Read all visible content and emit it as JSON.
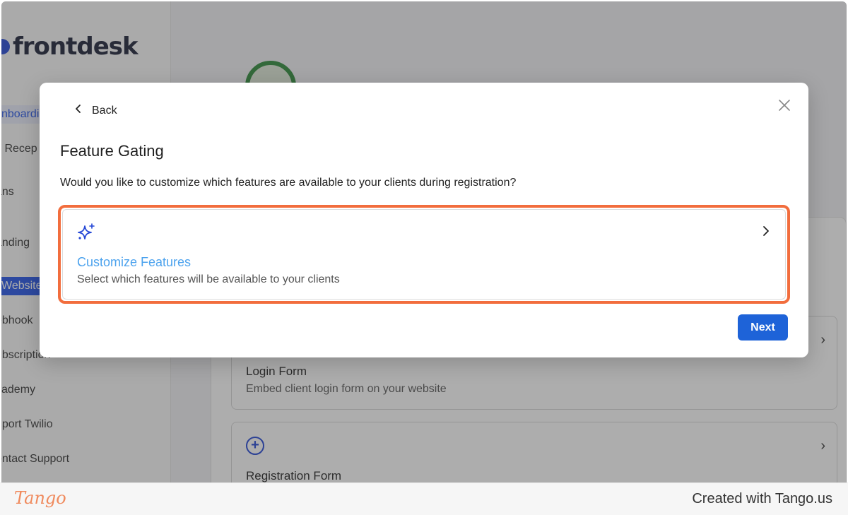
{
  "sidebar": {
    "logo_text": "frontdesk",
    "items": [
      {
        "label": "nboarding"
      },
      {
        "label": "y Recep"
      },
      {
        "label": "ans"
      },
      {
        "label": "anding"
      },
      {
        "label": "Website"
      },
      {
        "label": "ebhook"
      },
      {
        "label": "ubscription"
      },
      {
        "label": "cademy"
      },
      {
        "label": "nport Twilio"
      },
      {
        "label": "ontact Support"
      }
    ]
  },
  "background": {
    "cards": [
      {
        "title": "Login Form",
        "description": "Embed client login form on your website"
      },
      {
        "title": "Registration Form",
        "icon": "plus-circle-icon"
      }
    ]
  },
  "modal": {
    "back_label": "Back",
    "title": "Feature Gating",
    "question": "Would you like to customize which features are available to your clients during registration?",
    "option": {
      "icon": "sparkle-icon",
      "title": "Customize Features",
      "description": "Select which features will be available to your clients"
    },
    "next_label": "Next"
  },
  "footer": {
    "logo": "Tango",
    "text": "Created with Tango.us"
  },
  "colors": {
    "accent": "#1e63d8",
    "highlight": "#f26d3d",
    "option_title": "#4da3ee",
    "brand": "#2454e8"
  }
}
